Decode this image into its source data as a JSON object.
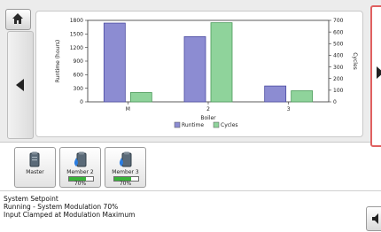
{
  "chart_data": {
    "type": "bar",
    "categories": [
      "M",
      "2",
      "3"
    ],
    "xlabel": "Boiler",
    "ylabel": "Runtime (hours)",
    "y2label": "Cycles",
    "ylim": [
      0,
      1800
    ],
    "y2lim": [
      0,
      700
    ],
    "yticks": [
      0,
      300,
      600,
      900,
      1200,
      1500,
      1800
    ],
    "y2ticks": [
      0,
      100,
      200,
      300,
      400,
      500,
      600,
      700
    ],
    "legend_position": "bottom",
    "series": [
      {
        "name": "Runtime",
        "axis": "left",
        "color": "#8c8cd2",
        "values": [
          1740,
          1440,
          350
        ]
      },
      {
        "name": "Cycles",
        "axis": "right",
        "color": "#8fd39b",
        "values": [
          80,
          680,
          95
        ]
      }
    ]
  },
  "tiles": [
    {
      "label": "Master"
    },
    {
      "label": "Member 2",
      "percent": "70%",
      "level": 0.7
    },
    {
      "label": "Member 3",
      "percent": "70%",
      "level": 0.7
    }
  ],
  "status": {
    "line1": "System Setpoint",
    "line2": "Running - System Modulation 70%",
    "line3": "Input Clamped at Modulation Maximum"
  },
  "icons": {
    "home": "home-icon",
    "left": "arrow-left-icon",
    "right": "arrow-right-icon",
    "speaker": "speaker-icon",
    "boiler": "boiler-icon",
    "boiler_flame": "boiler-flame-icon"
  }
}
